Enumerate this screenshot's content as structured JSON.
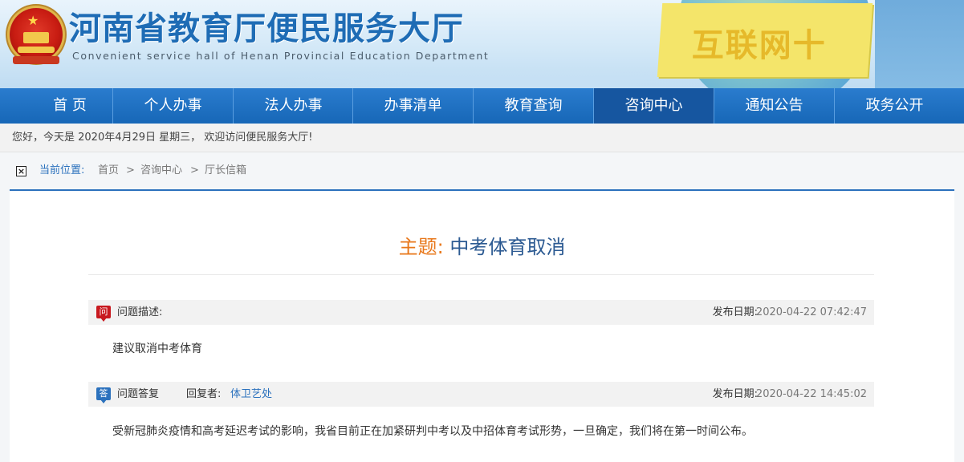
{
  "header": {
    "title": "河南省教育厅便民服务大厅",
    "subtitle": "Convenient service hall of Henan Provincial Education Department",
    "badge_text": "互联网十"
  },
  "nav": {
    "items": [
      {
        "label": "首 页"
      },
      {
        "label": "个人办事"
      },
      {
        "label": "法人办事"
      },
      {
        "label": "办事清单"
      },
      {
        "label": "教育查询"
      },
      {
        "label": "咨询中心"
      },
      {
        "label": "通知公告"
      },
      {
        "label": "政务公开"
      }
    ],
    "active": "咨询中心"
  },
  "greeting": "您好，今天是 2020年4月29日 星期三， 欢迎访问便民服务大厅!",
  "breadcrumb": {
    "label": "当前位置:",
    "items": [
      "首页",
      "咨询中心",
      "厅长信箱"
    ],
    "separator": ">"
  },
  "topic": {
    "label": "主题:",
    "text": "中考体育取消"
  },
  "question": {
    "badge": "问",
    "label": "问题描述:",
    "date_label": "发布日期:",
    "date": "2020-04-22 07:42:47",
    "content": "建议取消中考体育"
  },
  "answer": {
    "badge": "答",
    "label": "问题答复",
    "replier_label": "回复者:",
    "replier": "体卫艺处",
    "date_label": "发布日期:",
    "date": "2020-04-22 14:45:02",
    "content": "受新冠肺炎疫情和高考延迟考试的影响，我省目前正在加紧研判中考以及中招体育考试形势，一旦确定，我们将在第一时间公布。"
  },
  "colors": {
    "nav_bg": "#1b6fc0",
    "nav_active": "#1656a0",
    "link": "#2b71bd",
    "topic_label": "#e8771a",
    "topic_text": "#2c5a92",
    "question_badge": "#c8191f"
  }
}
